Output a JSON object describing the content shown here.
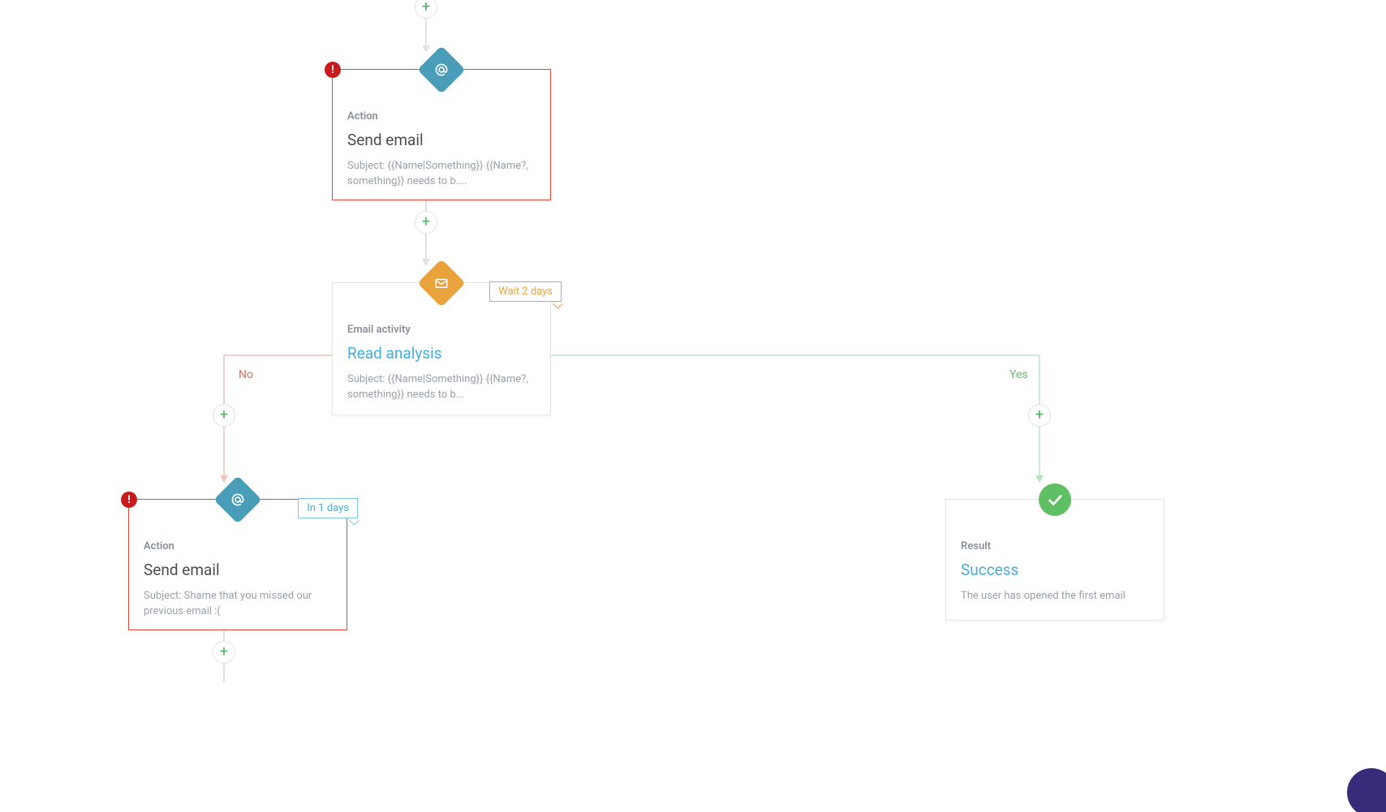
{
  "branchLabels": {
    "no": "No",
    "yes": "Yes"
  },
  "nodes": {
    "action1": {
      "category": "Action",
      "title": "Send email",
      "desc": "Subject: {{Name|Something}} {{Name?, something}} needs to b...."
    },
    "condition": {
      "category": "Email activity",
      "title": "Read analysis",
      "desc": "Subject: {{Name|Something}} {{Name?, something}} needs to b...",
      "tag": "Wait 2 days"
    },
    "action2": {
      "category": "Action",
      "title": "Send email",
      "desc": "Subject: Shame that you missed our previous email :(",
      "tag": "In 1 days"
    },
    "result": {
      "category": "Result",
      "title": "Success",
      "desc": "The user has opened the first email"
    }
  }
}
